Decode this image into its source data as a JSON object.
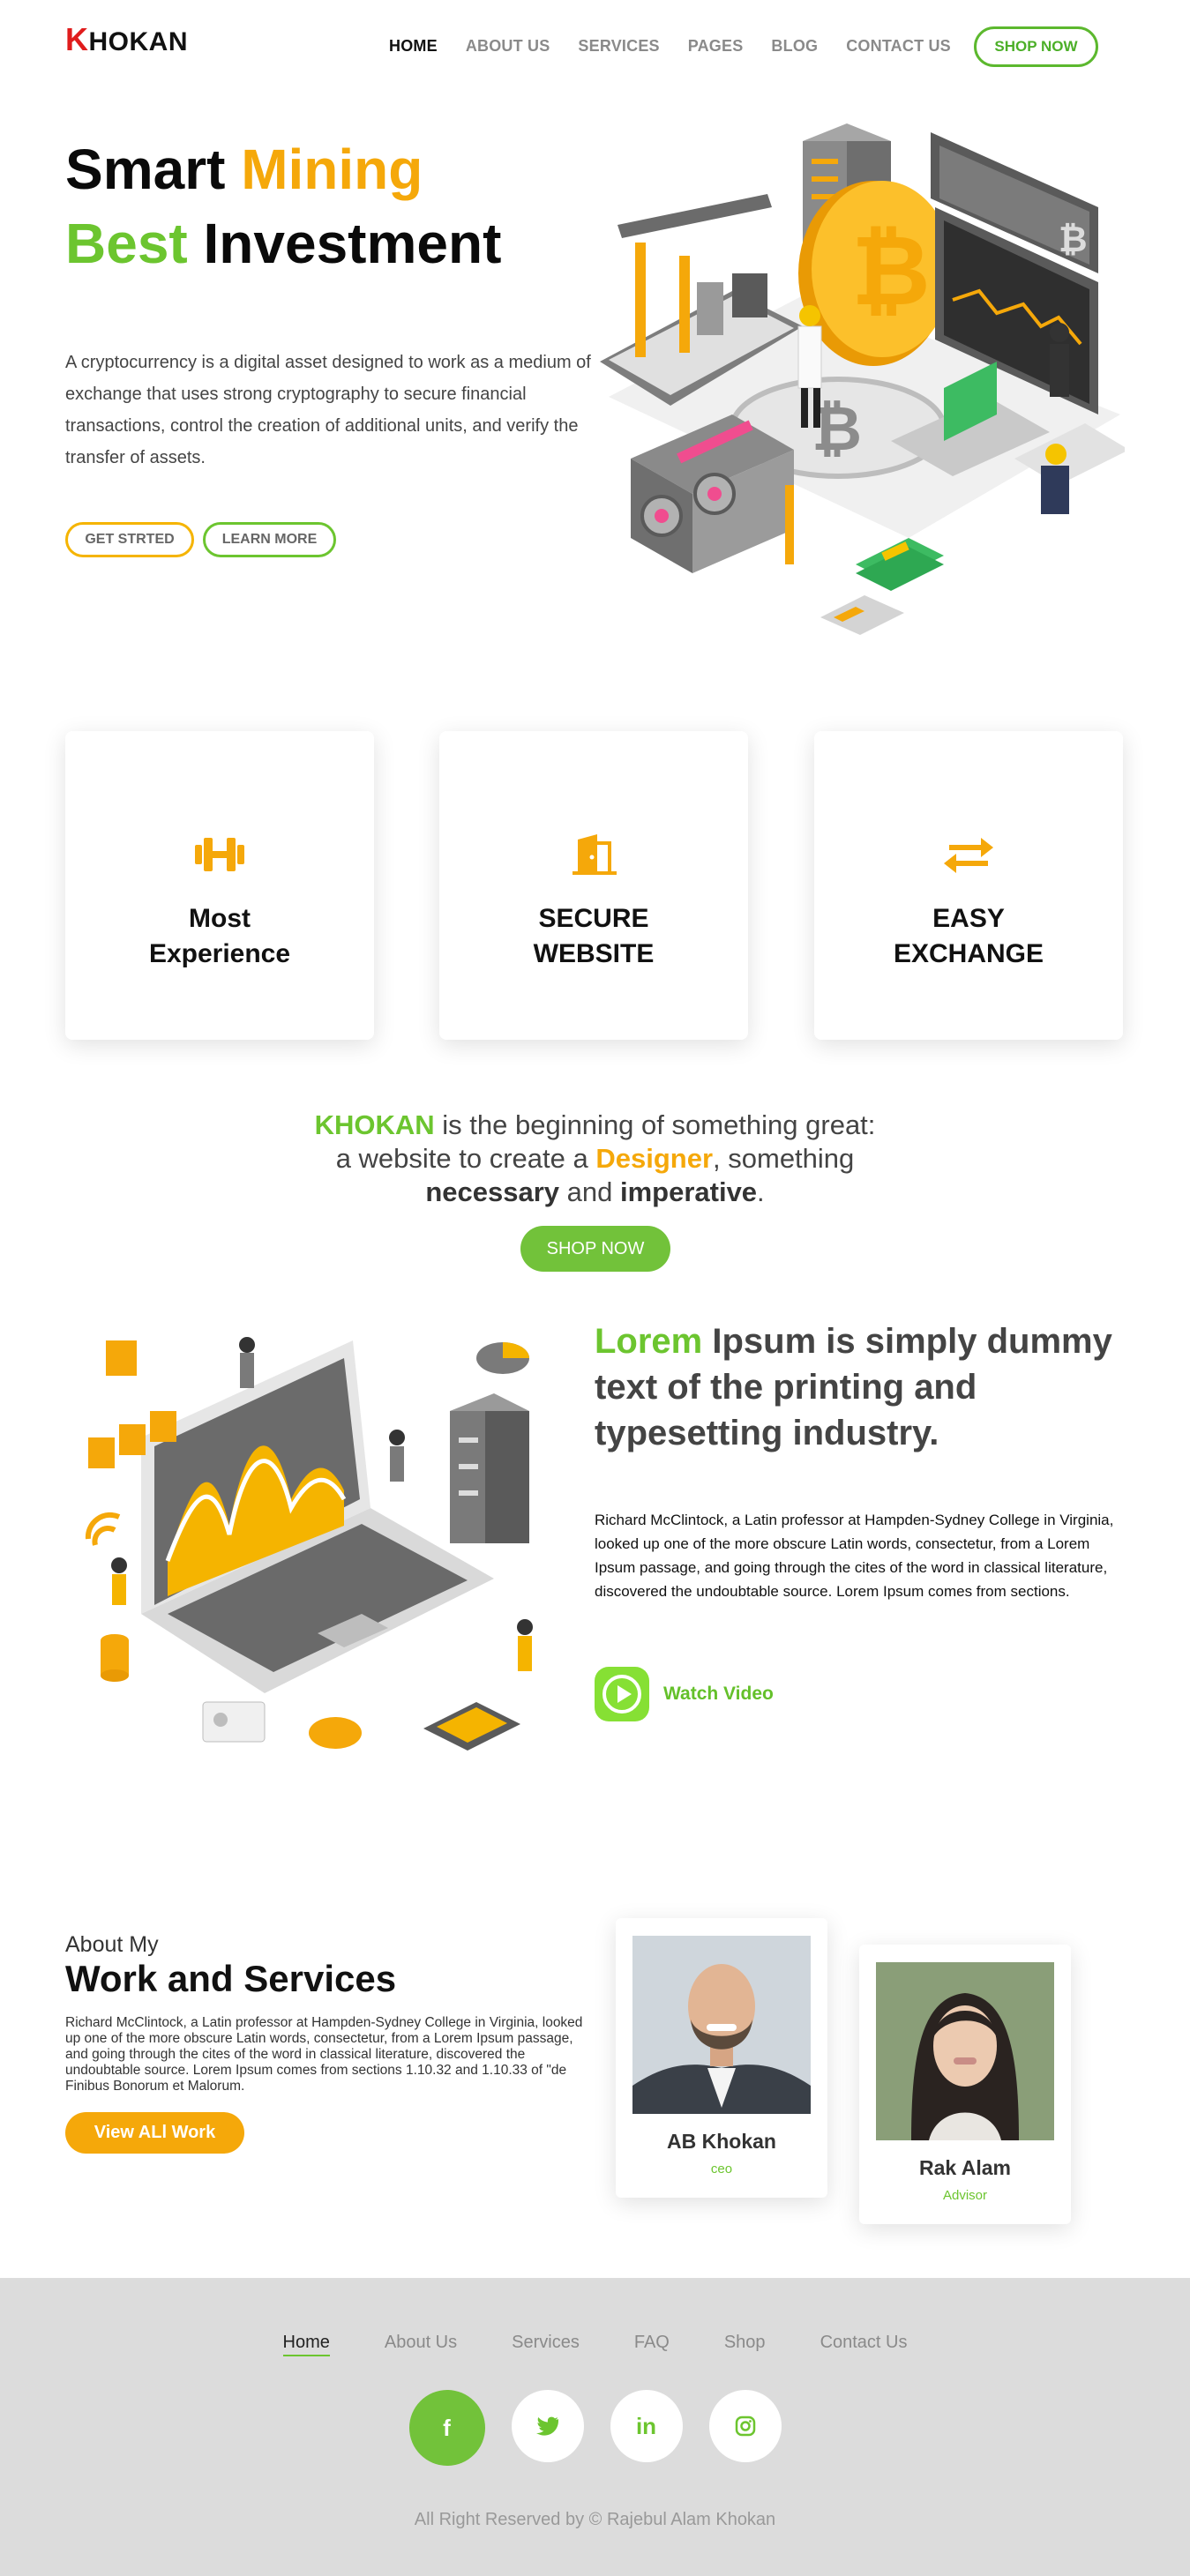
{
  "nav": {
    "logo_k": "K",
    "logo_rest": "HOKAN",
    "links": [
      "HOME",
      "ABOUT US",
      "SERVICES",
      "PAGES",
      "BLOG",
      "CONTACT US"
    ],
    "cta": "SHOP NOW"
  },
  "hero": {
    "line1_a": "Smart ",
    "line1_b": "Mining",
    "line2_a": "Best",
    "line2_b": " Investment",
    "text": "A cryptocurrency is a digital asset designed to work as a medium of exchange that uses strong cryptography to secure financial transactions, control the creation of additional units, and verify the transfer of assets.",
    "btn_primary": "GET STRTED",
    "btn_secondary": "LEARN MORE"
  },
  "features": [
    {
      "title": "Most Experience",
      "icon": "dumbbell-icon"
    },
    {
      "title": "SECURE WEBSITE",
      "icon": "door-icon"
    },
    {
      "title": "EASY EXCHANGE",
      "icon": "exchange-arrows-icon"
    }
  ],
  "tagline": {
    "brand": "KHOKAN",
    "part1": " is the beginning of something great:",
    "part2": "a website to create a ",
    "designer": "Designer",
    "part3": ", something",
    "necessary": "necessary",
    "and": " and ",
    "imperative": "imperative",
    "dot": ".",
    "cta": "SHOP NOW"
  },
  "about": {
    "title_green": "Lorem",
    "title_rest": " Ipsum is simply dummy text of the printing and typesetting industry.",
    "text": "Richard McClintock, a Latin professor at Hampden-Sydney College in Virginia, looked up one of the more obscure Latin words, consectetur, from a Lorem Ipsum passage, and going through the cites of the word in classical literature, discovered the undoubtable source. Lorem Ipsum comes from sections.",
    "watch": "Watch Video"
  },
  "work": {
    "kicker": "About My",
    "title": "Work and Services",
    "text": "Richard McClintock, a Latin professor at Hampden-Sydney College in Virginia, looked up one of the more obscure Latin words, consectetur, from a Lorem Ipsum passage, and going through the cites of the word in classical literature, discovered the undoubtable source. Lorem Ipsum comes from sections 1.10.32 and 1.10.33 of \"de Finibus Bonorum et Malorum.",
    "cta": "View ALl Work",
    "members": [
      {
        "name": "AB Khokan",
        "role": "ceo"
      },
      {
        "name": "Rak Alam",
        "role": "Advisor"
      }
    ]
  },
  "footer": {
    "links": [
      "Home",
      "About Us",
      "Services",
      "FAQ",
      "Shop",
      "Contact Us"
    ],
    "socials": [
      {
        "icon": "facebook-icon",
        "glyph": "f"
      },
      {
        "icon": "twitter-icon",
        "glyph": "t"
      },
      {
        "icon": "linkedin-icon",
        "glyph": "in"
      },
      {
        "icon": "instagram-icon",
        "glyph": "◎"
      }
    ],
    "copyright": "All Right Reserved by © Rajebul Alam Khokan"
  },
  "colors": {
    "green": "#6cc52f",
    "orange": "#f5a80a",
    "red": "#e01c1c"
  }
}
